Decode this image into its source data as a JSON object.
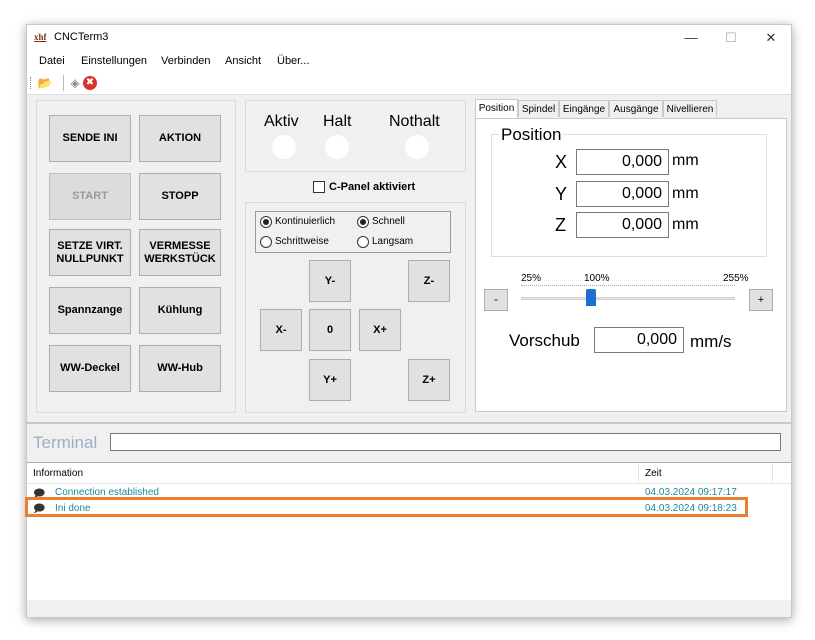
{
  "window": {
    "logo": "xhf",
    "title": "CNCTerm3",
    "minimize": "—",
    "maximize": "☐",
    "close": "✕"
  },
  "menu": [
    "Datei",
    "Einstellungen",
    "Verbinden",
    "Ansicht",
    "Über..."
  ],
  "toolbar": {
    "icons": [
      "open-folder-icon",
      "connect-icon",
      "stop-icon"
    ],
    "open_glyph": "📂",
    "connect_glyph": "◈",
    "stop_glyph": "✖"
  },
  "buttons": {
    "sende_ini": "SENDE INI",
    "aktion": "AKTION",
    "start": "START",
    "stopp": "STOPP",
    "setze_virt": "SETZE VIRT.\nNULLPUNKT",
    "vermesse": "VERMESSE\nWERKSTÜCK",
    "spannzange": "Spannzange",
    "kuehlung": "Kühlung",
    "ww_deckel": "WW-Deckel",
    "ww_hub": "WW-Hub"
  },
  "status_leds": {
    "aktiv": "Aktiv",
    "halt": "Halt",
    "nothalt": "Nothalt"
  },
  "cpanel": {
    "label": "C-Panel aktiviert",
    "checked": false
  },
  "mode": {
    "kontinuierlich": "Kontinuierlich",
    "schrittweise": "Schrittweise",
    "schnell": "Schnell",
    "langsam": "Langsam",
    "selected_motion": "Kontinuierlich",
    "selected_speed": "Schnell"
  },
  "jog": {
    "y_minus": "Y-",
    "y_plus": "Y+",
    "x_minus": "X-",
    "x_plus": "X+",
    "zero": "0",
    "z_minus": "Z-",
    "z_plus": "Z+"
  },
  "tabs": [
    "Position",
    "Spindel",
    "Eingänge",
    "Ausgänge",
    "Nivellieren"
  ],
  "active_tab": "Position",
  "position": {
    "group_title": "Position",
    "unit": "mm",
    "axes": [
      {
        "name": "X",
        "value": "0,000"
      },
      {
        "name": "Y",
        "value": "0,000"
      },
      {
        "name": "Z",
        "value": "0,000"
      }
    ]
  },
  "feed": {
    "min_label": "25%",
    "mid_label": "100%",
    "max_label": "255%",
    "minus": "-",
    "plus": "+",
    "level_percent": 100,
    "label": "Vorschub",
    "value": "0,000",
    "unit": "mm/s"
  },
  "terminal": {
    "label": "Terminal",
    "input_value": ""
  },
  "log": {
    "col_info": "Information",
    "col_time": "Zeit",
    "rows": [
      {
        "message": "Connection established",
        "time": "04.03.2024 09:17:17"
      },
      {
        "message": "Ini done",
        "time": "04.03.2024 09:18:23"
      }
    ]
  },
  "colors": {
    "highlight": "#ed7d31",
    "log_text": "#1a8a9a",
    "terminal_label": "#9ab0c8"
  }
}
